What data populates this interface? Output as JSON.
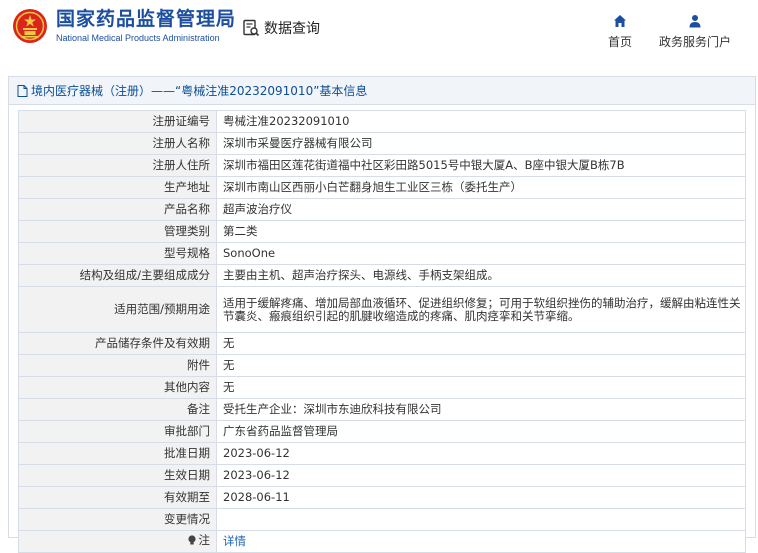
{
  "header": {
    "logo_cn": "国家药品监督管理局",
    "logo_en": "National Medical Products Administration",
    "query_label": "数据查询",
    "nav": [
      {
        "label": "首页",
        "icon": "home-icon"
      },
      {
        "label": "政务服务门户",
        "icon": "user-icon"
      }
    ]
  },
  "panel": {
    "title": "境内医疗器械（注册）——“粤械注准20232091010”基本信息"
  },
  "rows": [
    {
      "key": "注册证编号",
      "value": "粤械注准20232091010"
    },
    {
      "key": "注册人名称",
      "value": "深圳市采曼医疗器械有限公司"
    },
    {
      "key": "注册人住所",
      "value": "深圳市福田区莲花街道福中社区彩田路5015号中银大厦A、B座中银大厦B栋7B"
    },
    {
      "key": "生产地址",
      "value": "深圳市南山区西丽小白芒翻身旭生工业区三栋（委托生产）"
    },
    {
      "key": "产品名称",
      "value": "超声波治疗仪"
    },
    {
      "key": "管理类别",
      "value": "第二类"
    },
    {
      "key": "型号规格",
      "value": "SonoOne"
    },
    {
      "key": "结构及组成/主要组成成分",
      "value": "主要由主机、超声治疗探头、电源线、手柄支架组成。"
    },
    {
      "key": "适用范围/预期用途",
      "value": "适用于缓解疼痛、增加局部血液循环、促进组织修复；可用于软组织挫伤的辅助治疗，缓解由粘连性关节囊炎、瘢痕组织引起的肌腱收缩造成的疼痛、肌肉痉挛和关节挛缩。"
    },
    {
      "key": "产品储存条件及有效期",
      "value": "无"
    },
    {
      "key": "附件",
      "value": "无"
    },
    {
      "key": "其他内容",
      "value": "无"
    },
    {
      "key": "备注",
      "value": "受托生产企业：深圳市东迪欣科技有限公司"
    },
    {
      "key": "审批部门",
      "value": "广东省药品监督管理局"
    },
    {
      "key": "批准日期",
      "value": "2023-06-12"
    },
    {
      "key": "生效日期",
      "value": "2023-06-12"
    },
    {
      "key": "有效期至",
      "value": "2028-06-11"
    },
    {
      "key": "变更情况",
      "value": ""
    },
    {
      "key": "注",
      "value": "详情",
      "icon": "lightbulb-icon"
    }
  ],
  "colors": {
    "brand_blue": "#1d4fa0",
    "link_blue": "#1a62b8",
    "emblem_red": "#d9261c",
    "emblem_gold": "#f2c744"
  }
}
